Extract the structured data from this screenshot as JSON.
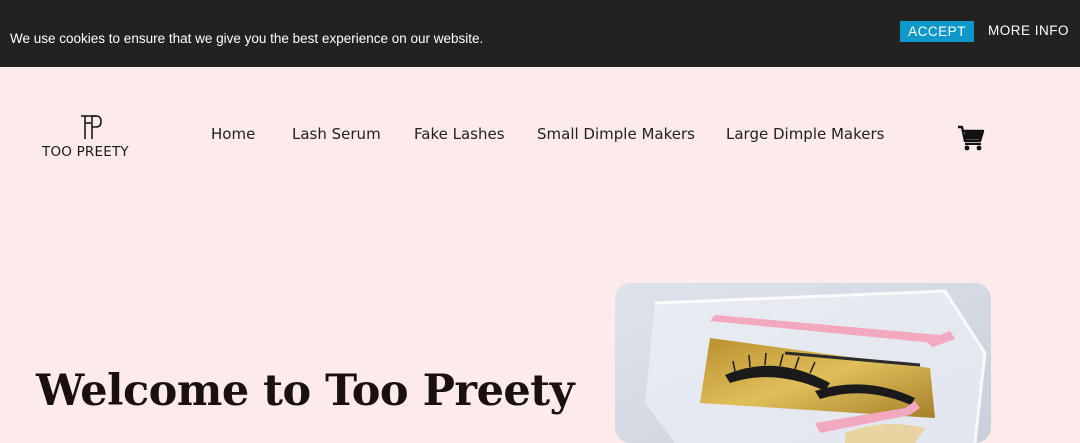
{
  "cookie_banner": {
    "message": "We use cookies to ensure that we give you the best experience on our website.",
    "accept_label": "ACCEPT",
    "more_info_label": "MORE INFO"
  },
  "header": {
    "logo_text": "TOO PREETY",
    "nav": [
      {
        "label": "Home"
      },
      {
        "label": "Lash Serum"
      },
      {
        "label": "Fake Lashes"
      },
      {
        "label": "Small Dimple Makers"
      },
      {
        "label": "Large Dimple Makers"
      }
    ],
    "cart_icon": "shopping-cart-icon"
  },
  "hero": {
    "title": "Welcome to Too Preety"
  },
  "colors": {
    "page_background": "#fdeaea",
    "banner_background": "#222222",
    "accept_button": "#0e98c9"
  }
}
